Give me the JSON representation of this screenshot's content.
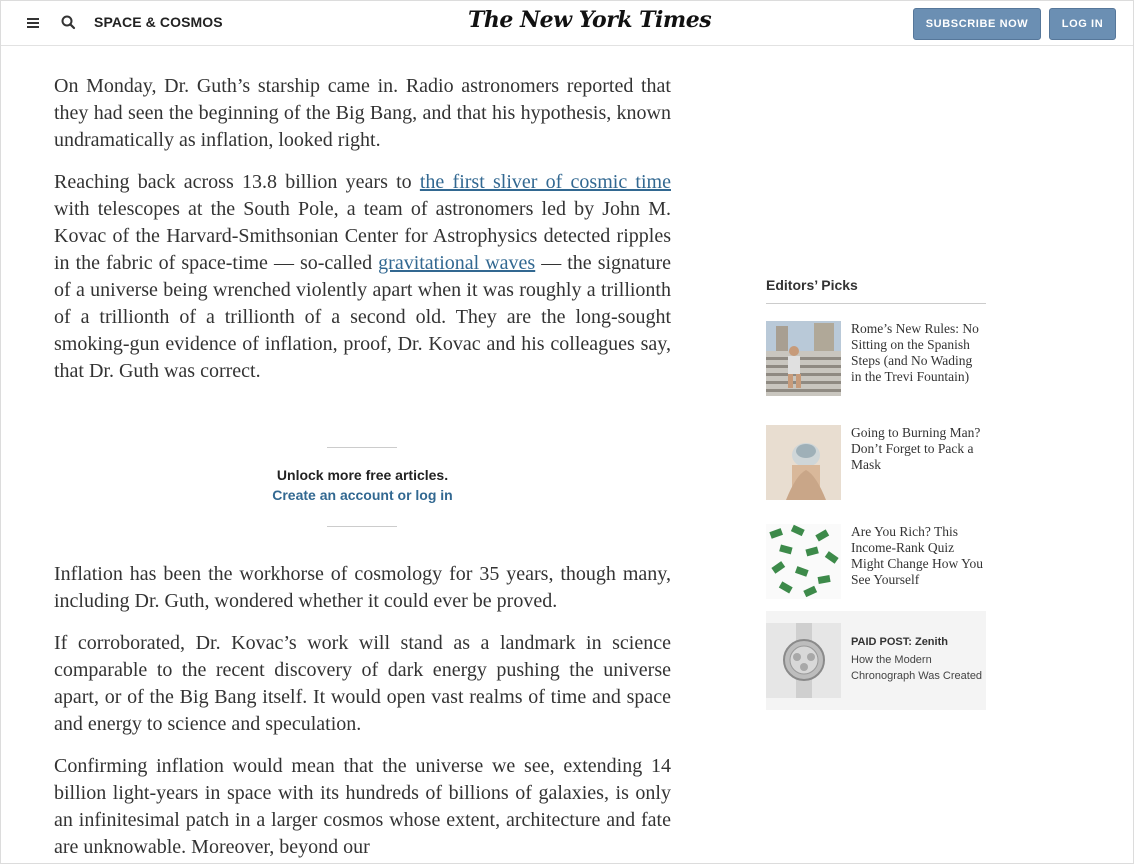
{
  "header": {
    "section": "SPACE & COSMOS",
    "logo": "The New York Times",
    "subscribe_label": "SUBSCRIBE NOW",
    "login_label": "LOG IN"
  },
  "article": {
    "p1": "On Monday, Dr. Guth’s starship came in. Radio astronomers reported that they had seen the beginning of the Big Bang, and that his hypothesis, known undramatically as inflation, looked right.",
    "p2_a": "Reaching back across 13.8 billion years to ",
    "p2_link1": "the first sliver of cosmic time",
    "p2_b": " with telescopes at the South Pole, a team of astronomers led by John M. Kovac of the Harvard-Smithsonian Center for Astrophysics detected ripples in the fabric of space-time — so-called ",
    "p2_link2": "gravitational waves",
    "p2_c": " — the signature of a universe being wrenched violently apart when it was roughly a trillionth of a trillionth of a trillionth of a second old. They are the long-sought smoking-gun evidence of inflation, proof, Dr. Kovac and his colleagues say, that Dr. Guth was correct.",
    "p3": "Inflation has been the workhorse of cosmology for 35 years, though many, including Dr. Guth, wondered whether it could ever be proved.",
    "p4": "If corroborated, Dr. Kovac’s work will stand as a landmark in science comparable to the recent discovery of dark energy pushing the universe apart, or of the Big Bang itself. It would open vast realms of time and space and energy to science and speculation.",
    "p5": "Confirming inflation would mean that the universe we see, extending 14 billion light-years in space with its hundreds of billions of galaxies, is only an infinitesimal patch in a larger cosmos whose extent, architecture and fate are unknowable. Moreover, beyond our"
  },
  "unlock": {
    "title": "Unlock more free articles.",
    "link": "Create an account or log in"
  },
  "sidebar": {
    "heading": "Editors’ Picks",
    "picks": [
      {
        "title": "Rome’s New Rules: No Sitting on the Spanish Steps (and No Wading in the Trevi Fountain)"
      },
      {
        "title": "Going to Burning Man? Don’t Forget to Pack a Mask"
      },
      {
        "title": "Are You Rich? This Income-Rank Quiz Might Change How You See Yourself"
      }
    ],
    "paid": {
      "label": "PAID POST: Zenith",
      "title": "How the Modern Chronograph Was Created"
    }
  },
  "colors": {
    "link": "#326891",
    "button": "#6b8fb3"
  }
}
